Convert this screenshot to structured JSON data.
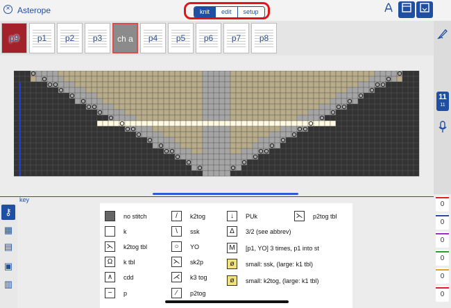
{
  "app": {
    "document_title": "Asterope"
  },
  "toolbar": {
    "modes": [
      "knit",
      "edit",
      "setup"
    ],
    "active_mode": "knit",
    "icons": [
      "pdf-icon",
      "split-view-icon",
      "chart-view-icon"
    ]
  },
  "thumbnails": [
    {
      "label": "p9"
    },
    {
      "label": "p1"
    },
    {
      "label": "p2"
    },
    {
      "label": "p3"
    },
    {
      "label": "ch a"
    },
    {
      "label": "p4"
    },
    {
      "label": "p5"
    },
    {
      "label": "p6"
    },
    {
      "label": "p7"
    },
    {
      "label": "p8"
    }
  ],
  "selected_thumbnail": "ch a",
  "right_rail": {
    "row_number": "11",
    "row_sub": "11",
    "icons": [
      "pen-icon",
      "microphone-icon"
    ]
  },
  "key": {
    "label": "key",
    "columns": [
      [
        {
          "label": "no stitch",
          "symbol": ""
        },
        {
          "label": "k",
          "symbol": ""
        },
        {
          "label": "k2tog tbl",
          "symbol": "⋋"
        },
        {
          "label": "k tbl",
          "symbol": "Ω"
        },
        {
          "label": "cdd",
          "symbol": "∧"
        },
        {
          "label": "p",
          "symbol": "−"
        }
      ],
      [
        {
          "label": "k2tog",
          "symbol": "/"
        },
        {
          "label": "ssk",
          "symbol": "\\"
        },
        {
          "label": "YO",
          "symbol": "○"
        },
        {
          "label": "sk2p",
          "symbol": "⋋"
        },
        {
          "label": "k3 tog",
          "symbol": "⋌"
        },
        {
          "label": "p2tog",
          "symbol": "⁄"
        }
      ],
      [
        {
          "label": "PUk",
          "symbol": "↓"
        },
        {
          "label": "3/2 (see abbrev)",
          "symbol": "Δ"
        },
        {
          "label": "[p1, YO] 3 times, p1 into st",
          "symbol": "M"
        },
        {
          "label": "small: ssk, (large: k1 tbl)",
          "symbol": "ø"
        },
        {
          "label": "small: k2tog, (large: k1 tbl)",
          "symbol": "ø"
        }
      ],
      [
        {
          "label": "p2tog tbl",
          "symbol": "⋋"
        }
      ]
    ]
  },
  "counters": [
    {
      "value": "0",
      "color": "#e02020"
    },
    {
      "value": "0",
      "color": "#1f4fa3"
    },
    {
      "value": "0",
      "color": "#9b30c8"
    },
    {
      "value": "0",
      "color": "#2aa02a"
    },
    {
      "value": "0",
      "color": "#e0a020"
    },
    {
      "value": "0",
      "color": "#e02020"
    }
  ],
  "colors": {
    "accent": "#1f4fa3",
    "highlight_red": "#e01616",
    "beige": "#b7ab89",
    "grey": "#a5a5a5",
    "dark": "#333333",
    "row_highlight": "#fff9e0"
  }
}
